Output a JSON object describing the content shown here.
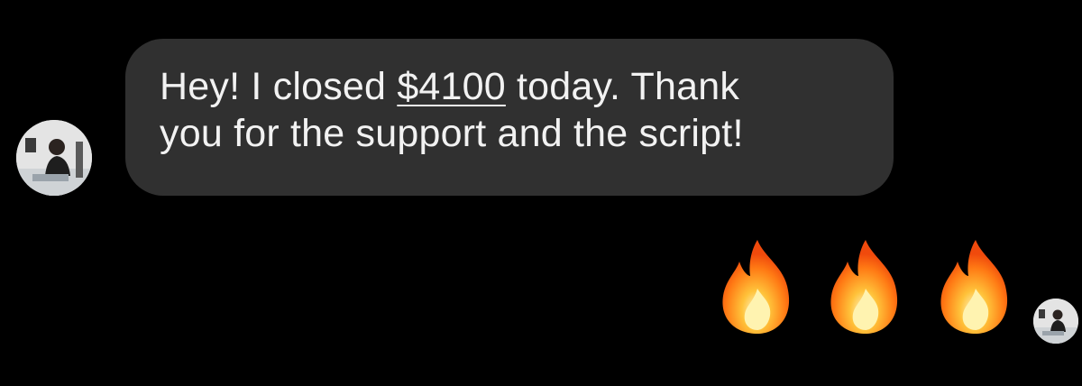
{
  "message": {
    "line1_prefix": "Hey! I closed ",
    "amount": "$4100",
    "line1_suffix": " today. Thank",
    "line2": "you for the support and the script!"
  },
  "reactions": [
    {
      "icon": "fire-emoji"
    },
    {
      "icon": "fire-emoji"
    },
    {
      "icon": "fire-emoji"
    }
  ],
  "colors": {
    "background": "#000000",
    "bubble": "#303030",
    "text": "#f2f2f2"
  }
}
